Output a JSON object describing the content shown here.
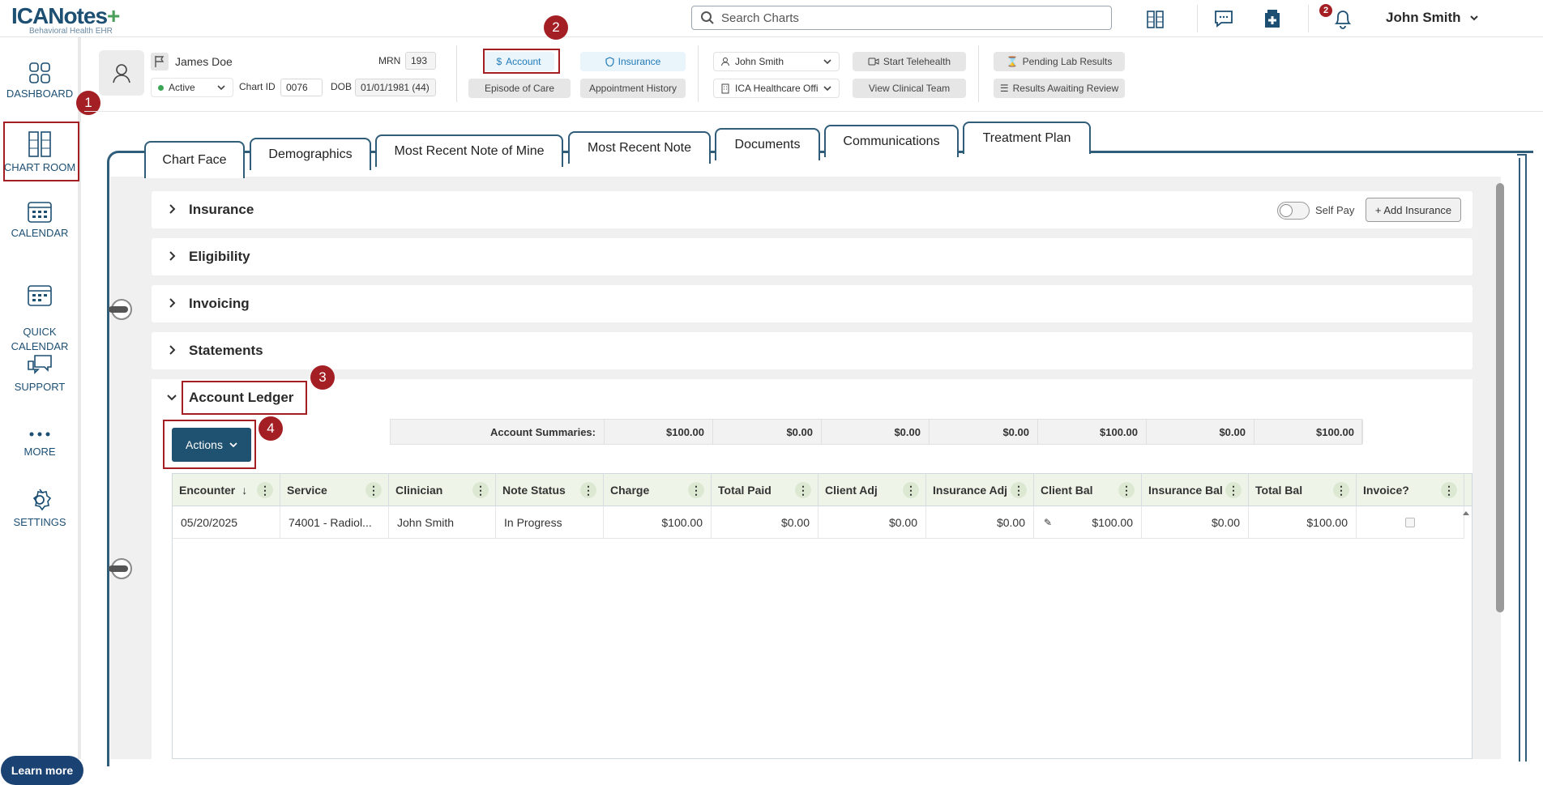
{
  "app": {
    "logo": "ICANotes",
    "logo_plus": "+",
    "tagline": "Behavioral Health EHR"
  },
  "search": {
    "placeholder": "Search Charts"
  },
  "notifications": {
    "count": "2"
  },
  "user": {
    "name": "John Smith"
  },
  "sidebar": {
    "items": [
      {
        "label": "DASHBOARD"
      },
      {
        "label": "CHART ROOM"
      },
      {
        "label": "CALENDAR"
      },
      {
        "label": "QUICK\nCALENDAR"
      },
      {
        "label": "SUPPORT"
      },
      {
        "label": "MORE"
      },
      {
        "label": "SETTINGS"
      }
    ],
    "learn_more": "Learn more"
  },
  "markers": [
    "1",
    "2",
    "3",
    "4"
  ],
  "patient": {
    "name": "James Doe",
    "status": "Active",
    "mrn_label": "MRN",
    "mrn": "193",
    "chart_id_label": "Chart ID",
    "chart_id": "0076",
    "dob_label": "DOB",
    "dob": "01/01/1981 (44)"
  },
  "buttons": {
    "account": "Account",
    "insurance": "Insurance",
    "episode": "Episode of Care",
    "appt_history": "Appointment History",
    "clinician_select": "John Smith",
    "office_select": "ICA Healthcare Offi",
    "telehealth": "Start Telehealth",
    "clinical_team": "View Clinical Team",
    "pending_lab": "Pending Lab Results",
    "results_review": "Results Awaiting Review"
  },
  "tabs": [
    "Chart Face",
    "Demographics",
    "Most Recent Note of Mine",
    "Most Recent Note",
    "Documents",
    "Communications",
    "Treatment Plan"
  ],
  "sections": [
    "Insurance",
    "Eligibility",
    "Invoicing",
    "Statements",
    "Account Ledger"
  ],
  "insurance_controls": {
    "self_pay": "Self Pay",
    "add_insurance": "+ Add Insurance"
  },
  "ledger": {
    "actions_label": "Actions",
    "summary_label": "Account Summaries:",
    "summaries": [
      "$100.00",
      "$0.00",
      "$0.00",
      "$0.00",
      "$100.00",
      "$0.00",
      "$100.00"
    ],
    "columns": [
      "Encounter",
      "Service",
      "Clinician",
      "Note Status",
      "Charge",
      "Total Paid",
      "Client Adj",
      "Insurance Adj",
      "Client Bal",
      "Insurance Bal",
      "Total Bal",
      "Invoice?"
    ],
    "rows": [
      {
        "encounter": "05/20/2025",
        "service": "74001 - Radiol...",
        "clinician": "John Smith",
        "note_status": "In Progress",
        "charge": "$100.00",
        "total_paid": "$0.00",
        "client_adj": "$0.00",
        "insurance_adj": "$0.00",
        "client_bal": "$100.00",
        "insurance_bal": "$0.00",
        "total_bal": "$100.00"
      }
    ]
  },
  "colors": {
    "brand": "#1d4f73",
    "highlight": "#a31f24",
    "header_green": "#eef5e8"
  }
}
